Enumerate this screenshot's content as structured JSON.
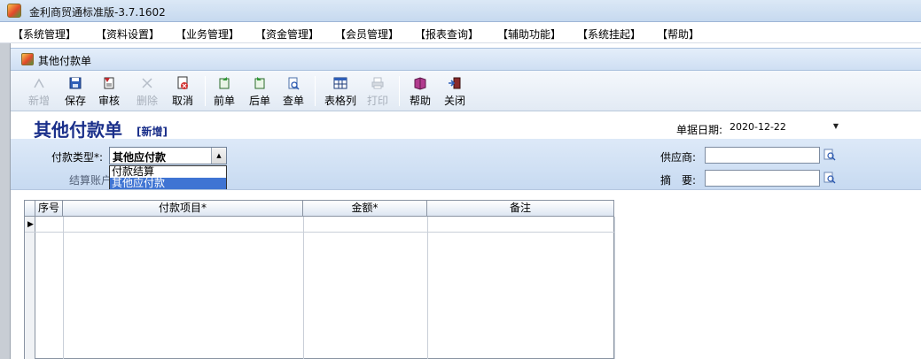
{
  "window": {
    "title": "金利商贸通标准版-3.7.1602"
  },
  "menu": [
    "【系统管理】",
    "【资料设置】",
    "【业务管理】",
    "【资金管理】",
    "【会员管理】",
    "【报表查询】",
    "【辅助功能】",
    "【系统挂起】",
    "【帮助】"
  ],
  "child": {
    "title": "其他付款单"
  },
  "toolbar": {
    "new": "新增",
    "save": "保存",
    "audit": "审核",
    "delete": "删除",
    "cancel": "取消",
    "prev": "前单",
    "next": "后单",
    "query": "查单",
    "columns": "表格列",
    "print": "打印",
    "help": "帮助",
    "close": "关闭"
  },
  "form": {
    "heading": "其他付款单",
    "mode_badge": "[新增]",
    "date_label": "单据日期:",
    "date_value": "2020-12-22",
    "type_label": "付款类型*:",
    "type_value": "其他应付款",
    "type_options": [
      "付款结算",
      "其他应付款"
    ],
    "type_selected_index": 1,
    "account_label": "结算账户:",
    "supplier_label": "供应商:",
    "supplier_value": "",
    "summary_label": "摘　要:",
    "summary_value": ""
  },
  "grid": {
    "columns": [
      "序号",
      "付款项目*",
      "金额*",
      "备注"
    ],
    "current_row_marker": "▶"
  },
  "colors": {
    "heading": "#1a2f8a",
    "form_band": "#c7daf1",
    "selection": "#3f74d3"
  }
}
